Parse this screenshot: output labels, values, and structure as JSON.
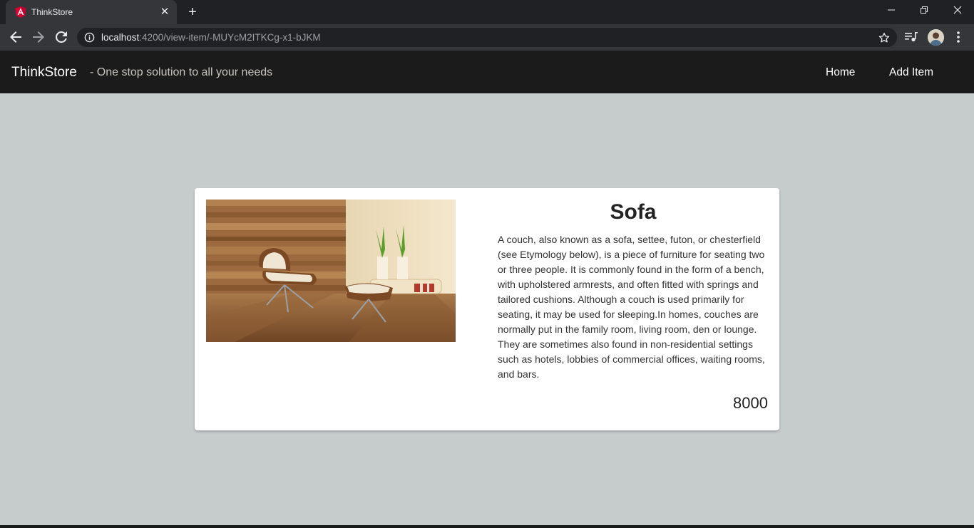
{
  "browser": {
    "tab_title": "ThinkStore",
    "url_host": "localhost",
    "url_path": ":4200/view-item/-MUYcM2ITKCg-x1-bJKM"
  },
  "navbar": {
    "brand": "ThinkStore",
    "tagline": "- One stop solution to all your needs",
    "links": [
      "Home",
      "Add Item"
    ]
  },
  "item": {
    "title": "Sofa",
    "description": "A couch, also known as a sofa, settee, futon, or chesterfield (see Etymology below), is a piece of furniture for seating two or three people. It is commonly found in the form of a bench, with upholstered armrests, and often fitted with springs and tailored cushions. Although a couch is used primarily for seating, it may be used for sleeping.In homes, couches are normally put in the family room, living room, den or lounge. They are sometimes also found in non-residential settings such as hotels, lobbies of commercial offices, waiting rooms, and bars.",
    "price": "8000"
  },
  "colors": {
    "page_background": "#c6cbcb",
    "navbar_background": "#1b1b1b",
    "card_background": "#ffffff"
  }
}
